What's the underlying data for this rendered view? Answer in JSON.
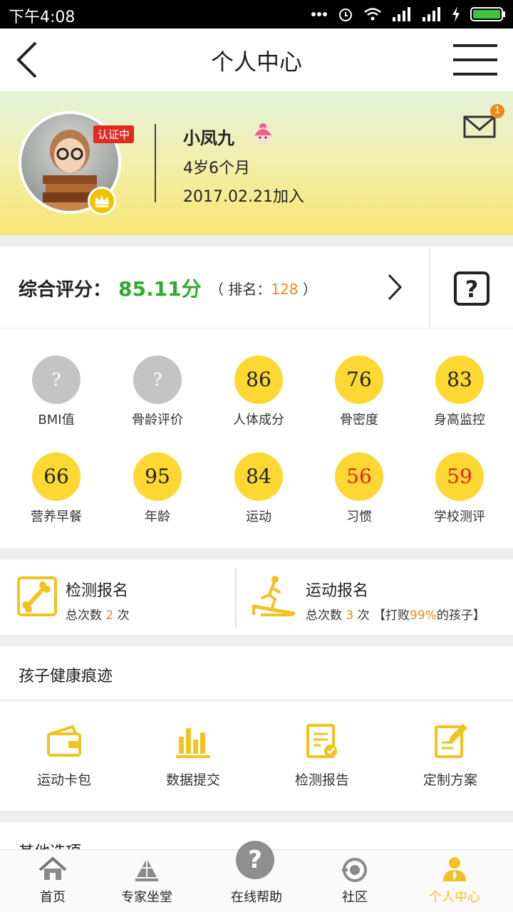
{
  "status_bar": {
    "time": "下午4:08"
  },
  "nav": {
    "title": "个人中心"
  },
  "profile": {
    "cert_badge": "认证中",
    "name": "小凤九",
    "age": "4岁6个月",
    "joined": "2017.02.21加入",
    "mail_count": "1"
  },
  "score": {
    "label": "综合评分：",
    "value": "85.11分",
    "rank_prefix": "（ 排名：",
    "rank_value": "128",
    "rank_suffix": " ）"
  },
  "metrics": [
    {
      "value": "?",
      "label": "BMI值",
      "style": "grey"
    },
    {
      "value": "?",
      "label": "骨龄评价",
      "style": "grey"
    },
    {
      "value": "86",
      "label": "人体成分",
      "style": "normal"
    },
    {
      "value": "76",
      "label": "骨密度",
      "style": "normal"
    },
    {
      "value": "83",
      "label": "身高监控",
      "style": "normal"
    },
    {
      "value": "66",
      "label": "营养早餐",
      "style": "normal"
    },
    {
      "value": "95",
      "label": "年龄",
      "style": "normal"
    },
    {
      "value": "84",
      "label": "运动",
      "style": "normal"
    },
    {
      "value": "56",
      "label": "习惯",
      "style": "red"
    },
    {
      "value": "59",
      "label": "学校测评",
      "style": "red"
    }
  ],
  "signup": {
    "test": {
      "title": "检测报名",
      "count_prefix": "总次数",
      "count": "2",
      "count_suffix": "次"
    },
    "sport": {
      "title": "运动报名",
      "count_prefix": "总次数",
      "count": "3",
      "count_suffix": "次",
      "beat_prefix": "【打败",
      "beat_value": "99%",
      "beat_suffix": "的孩子】"
    }
  },
  "trace": {
    "title": "孩子健康痕迹",
    "items": [
      {
        "label": "运动卡包",
        "icon": "wallet-icon"
      },
      {
        "label": "数据提交",
        "icon": "bar-chart-icon"
      },
      {
        "label": "检测报告",
        "icon": "report-icon"
      },
      {
        "label": "定制方案",
        "icon": "edit-plan-icon"
      }
    ]
  },
  "other": {
    "title": "其他选项"
  },
  "tabs": [
    {
      "label": "首页",
      "icon": "home-icon"
    },
    {
      "label": "专家坐堂",
      "icon": "expert-icon"
    },
    {
      "label": "在线帮助",
      "icon": "help-icon"
    },
    {
      "label": "社区",
      "icon": "community-icon"
    },
    {
      "label": "个人中心",
      "icon": "profile-icon",
      "active": true
    }
  ],
  "colors": {
    "accent": "#f2c320",
    "score_green": "#2eac2e",
    "highlight_orange": "#f08a18",
    "metric_yellow": "#fdd832",
    "metric_red_text": "#e8221b"
  }
}
